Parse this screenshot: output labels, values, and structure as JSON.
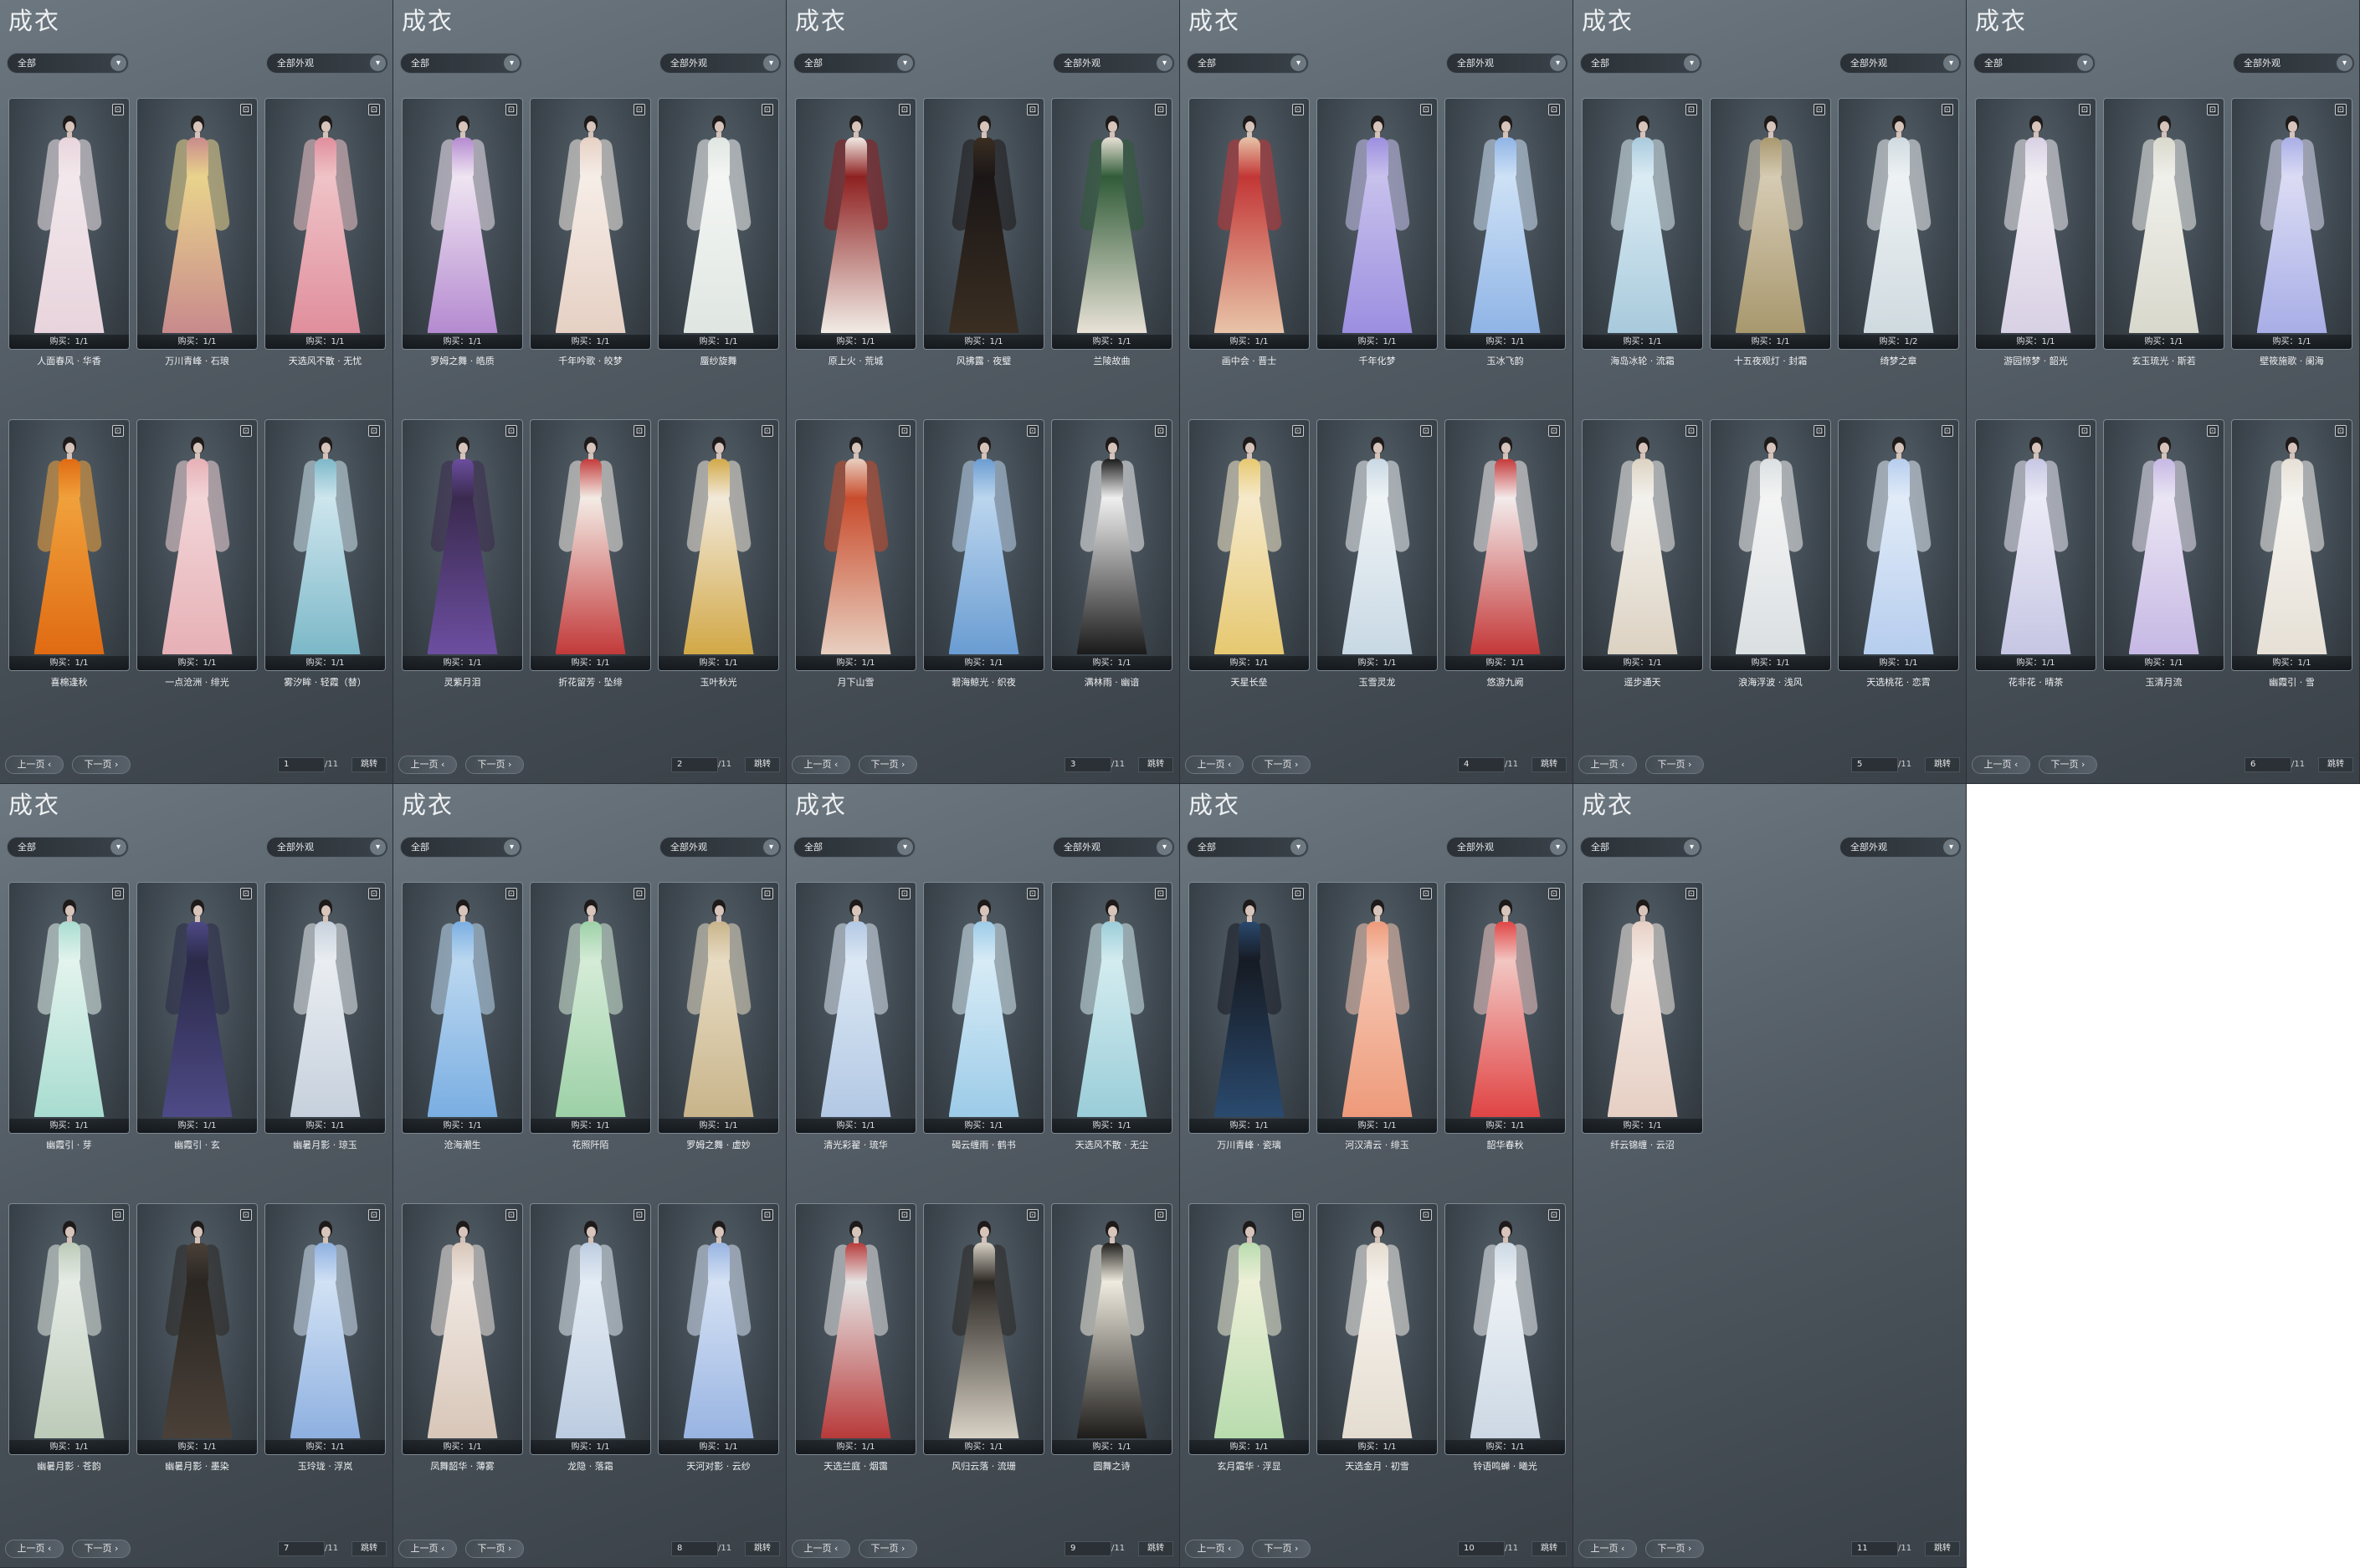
{
  "screen_title": "成衣",
  "filters": {
    "category": "全部",
    "appearance": "全部外观"
  },
  "chevron_glyph": "▾",
  "icons": {
    "dropdown": "chevron-down-icon",
    "tag": "shop-tag-icon",
    "prev": "chevron-left-icon",
    "next": "chevron-right-icon"
  },
  "pagination": {
    "prev_label": "上一页 ‹",
    "next_label": "下一页 ›",
    "total": "/11",
    "jump_label": "跳转"
  },
  "pages": [
    {
      "page": "1",
      "items": [
        {
          "name": "人面春风 · 华香",
          "buy": "购买：1/1",
          "tag": "⊡",
          "colors": [
            "#f2e8ec",
            "#e8d4dc"
          ]
        },
        {
          "name": "万川青峰 · 石琅",
          "buy": "购买：1/1",
          "tag": "⊡",
          "colors": [
            "#e9d48c",
            "#c88a8c"
          ]
        },
        {
          "name": "天选风不散 · 无忧",
          "buy": "购买：1/1",
          "tag": "⊡",
          "colors": [
            "#efc4c8",
            "#e08e9c"
          ]
        },
        {
          "name": "喜棉逢秋",
          "buy": "购买：1/1",
          "tag": "⊡",
          "colors": [
            "#f0a23c",
            "#e06a12"
          ]
        },
        {
          "name": "一点沧洲 · 绯光",
          "buy": "购买：1/1",
          "tag": "⊡",
          "colors": [
            "#f2d6d8",
            "#e6b0b6"
          ]
        },
        {
          "name": "雾汐眸 · 轻霞（替）",
          "buy": "购买：1/1",
          "tag": "⊡",
          "colors": [
            "#cfe6ee",
            "#7cb8c8"
          ]
        }
      ]
    },
    {
      "page": "2",
      "items": [
        {
          "name": "罗姆之舞 · 皓质",
          "buy": "购买：1/1",
          "tag": "⊡",
          "colors": [
            "#f0e6f2",
            "#b48ad0"
          ]
        },
        {
          "name": "千年吟歌 · 皎梦",
          "buy": "购买：1/1",
          "tag": "⊡",
          "colors": [
            "#f6eee8",
            "#e6d0c4"
          ]
        },
        {
          "name": "蜃纱旋舞",
          "buy": "购买：1/1",
          "tag": "⊡",
          "colors": [
            "#f4f6f4",
            "#dfe6e2"
          ]
        },
        {
          "name": "灵紫月泪",
          "buy": "购买：1/1",
          "tag": "⊡",
          "colors": [
            "#3a2a4e",
            "#6c4ea0"
          ]
        },
        {
          "name": "折花留芳 · 坠绯",
          "buy": "购买：1/1",
          "tag": "⊡",
          "colors": [
            "#f4eee8",
            "#c23a3a"
          ]
        },
        {
          "name": "玉叶秋光",
          "buy": "购买：1/1",
          "tag": "⊡",
          "colors": [
            "#f2eadc",
            "#d2a846"
          ]
        }
      ]
    },
    {
      "page": "3",
      "items": [
        {
          "name": "原上火 · 荒城",
          "buy": "购买：1/1",
          "tag": "⊡",
          "colors": [
            "#8c1e1e",
            "#f2ece6"
          ]
        },
        {
          "name": "风拂露 · 夜璧",
          "buy": "购买：1/1",
          "tag": "⊡",
          "colors": [
            "#1a1616",
            "#3a2e22"
          ]
        },
        {
          "name": "兰陵故曲",
          "buy": "购买：1/1",
          "tag": "⊡",
          "colors": [
            "#2e5a36",
            "#e8e2d6"
          ]
        },
        {
          "name": "月下山雪",
          "buy": "购买：1/1",
          "tag": "⊡",
          "colors": [
            "#c84a2a",
            "#e8cfc0"
          ]
        },
        {
          "name": "碧海鲸光 · 织夜",
          "buy": "购买：1/1",
          "tag": "⊡",
          "colors": [
            "#bcd6ee",
            "#6a9cd2"
          ]
        },
        {
          "name": "满林雨 · 幽谙",
          "buy": "购买：1/1",
          "tag": "⊡",
          "colors": [
            "#f2f2f2",
            "#1a1a1a"
          ]
        }
      ]
    },
    {
      "page": "4",
      "items": [
        {
          "name": "画中会 · 晋士",
          "buy": "购买：1/1",
          "tag": "⊡",
          "colors": [
            "#c23434",
            "#e8c4a8"
          ]
        },
        {
          "name": "千年化梦",
          "buy": "购买：1/1",
          "tag": "⊡",
          "colors": [
            "#c8c2ec",
            "#9c8ee0"
          ]
        },
        {
          "name": "玉冰飞韵",
          "buy": "购买：1/1",
          "tag": "⊡",
          "colors": [
            "#cfe2f6",
            "#8fb4e6"
          ]
        },
        {
          "name": "天星长垒",
          "buy": "购买：1/1",
          "tag": "⊡",
          "colors": [
            "#f6eacc",
            "#e6c870"
          ]
        },
        {
          "name": "玉雪灵龙",
          "buy": "购买：1/1",
          "tag": "⊡",
          "colors": [
            "#f0f4f6",
            "#c8d8e4"
          ]
        },
        {
          "name": "悠游九阙",
          "buy": "购买：1/1",
          "tag": "⊡",
          "colors": [
            "#f4eeee",
            "#c43838"
          ]
        }
      ]
    },
    {
      "page": "5",
      "items": [
        {
          "name": "海岛冰轮 · 流霜",
          "buy": "购买：1/1",
          "tag": "⊡",
          "colors": [
            "#dcecf4",
            "#a8cadc"
          ]
        },
        {
          "name": "十五夜观灯 · 封霜",
          "buy": "购买：1/1",
          "tag": "⊡",
          "colors": [
            "#d6cbb4",
            "#a8986e"
          ]
        },
        {
          "name": "绮梦之章",
          "buy": "购买：1/2",
          "tag": "⊡",
          "colors": [
            "#eef2f4",
            "#cfdae0"
          ]
        },
        {
          "name": "遥步通天",
          "buy": "购买：1/1",
          "tag": "⊡",
          "colors": [
            "#f4f2ee",
            "#dcd2c2"
          ]
        },
        {
          "name": "浪海浮波 · 浅风",
          "buy": "购买：1/1",
          "tag": "⊡",
          "colors": [
            "#f4f4f4",
            "#dadfe2"
          ]
        },
        {
          "name": "天选桃花 · 恋霄",
          "buy": "购买：1/1",
          "tag": "⊡",
          "colors": [
            "#e2ecf8",
            "#b6cdee"
          ]
        }
      ]
    },
    {
      "page": "6",
      "items": [
        {
          "name": "游园惊梦 · 韶光",
          "buy": "购买：1/1",
          "tag": "⊡",
          "colors": [
            "#f2eff4",
            "#d8d0e4"
          ]
        },
        {
          "name": "玄玉琉光 · 斯若",
          "buy": "购买：1/1",
          "tag": "⊡",
          "colors": [
            "#f0f0ec",
            "#d8d8cc"
          ]
        },
        {
          "name": "壁筱施歌 · 阑海",
          "buy": "购买：1/1",
          "tag": "⊡",
          "colors": [
            "#dcdcf4",
            "#a8aee6"
          ]
        },
        {
          "name": "花非花 · 晴茶",
          "buy": "购买：1/1",
          "tag": "⊡",
          "colors": [
            "#ecebf6",
            "#c6c6e4"
          ]
        },
        {
          "name": "玉清月流",
          "buy": "购买：1/1",
          "tag": "⊡",
          "colors": [
            "#ebe6f4",
            "#c6b8e4"
          ]
        },
        {
          "name": "幽霞引 · 雪",
          "buy": "购买：1/1",
          "tag": "⊡",
          "colors": [
            "#f6f4f0",
            "#e6e0d6"
          ]
        }
      ]
    },
    {
      "page": "7",
      "items": [
        {
          "name": "幽霞引 · 芽",
          "buy": "购买：1/1",
          "tag": "⊡",
          "colors": [
            "#e4f4ee",
            "#a8dcd0"
          ]
        },
        {
          "name": "幽霞引 · 玄",
          "buy": "购买：1/1",
          "tag": "⊡",
          "colors": [
            "#2a2a48",
            "#4e4a86"
          ]
        },
        {
          "name": "幽暑月影 · 琼玉",
          "buy": "购买：1/1",
          "tag": "⊡",
          "colors": [
            "#eaeef2",
            "#c6d0dc"
          ]
        },
        {
          "name": "幽暑月影 · 苍韵",
          "buy": "购买：1/1",
          "tag": "⊡",
          "colors": [
            "#e6ece6",
            "#bccab8"
          ]
        },
        {
          "name": "幽暑月影 · 墨染",
          "buy": "购买：1/1",
          "tag": "⊡",
          "colors": [
            "#2a2622",
            "#4a4038"
          ]
        },
        {
          "name": "玉玲珑 · 浮岚",
          "buy": "购买：1/1",
          "tag": "⊡",
          "colors": [
            "#d2e2f4",
            "#8eb0e0"
          ]
        }
      ]
    },
    {
      "page": "8",
      "items": [
        {
          "name": "沧海潮生",
          "buy": "购买：1/1",
          "tag": "⊡",
          "colors": [
            "#bcd8f0",
            "#7aaee2"
          ]
        },
        {
          "name": "花照阡陌",
          "buy": "购买：1/1",
          "tag": "⊡",
          "colors": [
            "#d6ecd8",
            "#9cd0a6"
          ]
        },
        {
          "name": "罗姆之舞 · 虚妙",
          "buy": "购买：1/1",
          "tag": "⊡",
          "colors": [
            "#e8dcc4",
            "#c8b48a"
          ]
        },
        {
          "name": "凤舞韶华 · 薄雾",
          "buy": "购买：1/1",
          "tag": "⊡",
          "colors": [
            "#f0e8e2",
            "#d8c6b8"
          ]
        },
        {
          "name": "龙隐 · 落霜",
          "buy": "购买：1/1",
          "tag": "⊡",
          "colors": [
            "#e4ecf4",
            "#bccce0"
          ]
        },
        {
          "name": "天河对影 · 云纱",
          "buy": "购买：1/1",
          "tag": "⊡",
          "colors": [
            "#d6e2f4",
            "#98b4e2"
          ]
        }
      ]
    },
    {
      "page": "9",
      "items": [
        {
          "name": "清光彩翟 · 琉华",
          "buy": "购买：1/1",
          "tag": "⊡",
          "colors": [
            "#dce8f4",
            "#b2c8e4"
          ]
        },
        {
          "name": "碣云缠雨 · 鹤书",
          "buy": "购买：1/1",
          "tag": "⊡",
          "colors": [
            "#d8ecf6",
            "#9ccbe8"
          ]
        },
        {
          "name": "天选风不散 · 无尘",
          "buy": "购买：1/1",
          "tag": "⊡",
          "colors": [
            "#d4ecf0",
            "#9acdd8"
          ]
        },
        {
          "name": "天选兰庭 · 烟霭",
          "buy": "购买：1/1",
          "tag": "⊡",
          "colors": [
            "#e6e6e6",
            "#b83a3a"
          ]
        },
        {
          "name": "风归云落 · 流珊",
          "buy": "购买：1/1",
          "tag": "⊡",
          "colors": [
            "#2a2622",
            "#d8d2c6"
          ]
        },
        {
          "name": "圆舞之诗",
          "buy": "购买：1/1",
          "tag": "⊡",
          "colors": [
            "#f2eee2",
            "#1e1c1a"
          ]
        }
      ]
    },
    {
      "page": "10",
      "items": [
        {
          "name": "万川青峰 · 瓷璃",
          "buy": "购买：1/1",
          "tag": "⊡",
          "colors": [
            "#161a22",
            "#2a4a6e"
          ]
        },
        {
          "name": "河汉清云 · 绯玉",
          "buy": "购买：1/1",
          "tag": "⊡",
          "colors": [
            "#f6c8b4",
            "#ee9a7a"
          ]
        },
        {
          "name": "韶华春秋",
          "buy": "购买：1/1",
          "tag": "⊡",
          "colors": [
            "#f2c8c4",
            "#e04444"
          ]
        },
        {
          "name": "玄月霜华 · 浮显",
          "buy": "购买：1/1",
          "tag": "⊡",
          "colors": [
            "#eef0d8",
            "#b8dcae"
          ]
        },
        {
          "name": "天选金月 · 初雪",
          "buy": "购买：1/1",
          "tag": "⊡",
          "colors": [
            "#f6f2ec",
            "#e4dcd0"
          ]
        },
        {
          "name": "铃语鸣蝉 · 曦光",
          "buy": "购买：1/1",
          "tag": "⊡",
          "colors": [
            "#eef2f6",
            "#ccd8e4"
          ]
        }
      ]
    },
    {
      "page": "11",
      "items": [
        {
          "name": "纤云锦缠 · 云沼",
          "buy": "购买：1/1",
          "tag": "⊡",
          "colors": [
            "#f6ece6",
            "#e6cfc4"
          ]
        }
      ]
    }
  ]
}
